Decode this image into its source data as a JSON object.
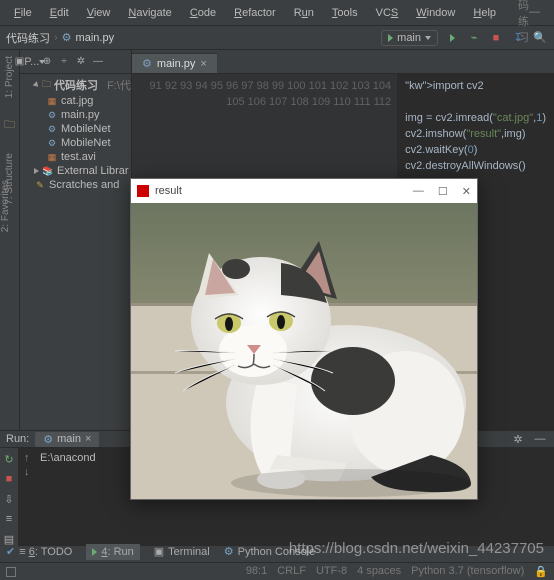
{
  "menu": {
    "file": "File",
    "edit": "Edit",
    "view": "View",
    "navigate": "Navigate",
    "code": "Code",
    "refactor": "Refactor",
    "run": "Run",
    "tools": "Tools",
    "vcs": "VCS",
    "window": "Window",
    "help": "Help"
  },
  "title_hint": "代码练习",
  "breadcrumb": {
    "root": "代码练习",
    "file": "main.py"
  },
  "run_config": "main",
  "sidebar": {
    "header_label": "P...",
    "items": [
      {
        "label": "代码练习",
        "hint": "F:\\代码"
      },
      {
        "label": "cat.jpg"
      },
      {
        "label": "main.py"
      },
      {
        "label": "MobileNet"
      },
      {
        "label": "MobileNet"
      },
      {
        "label": "test.avi"
      },
      {
        "label": "External Librar"
      },
      {
        "label": "Scratches and"
      }
    ]
  },
  "left_tools": {
    "project": "1: Project",
    "structure": "7: Structure",
    "favorites": "2: Favorites"
  },
  "editor": {
    "tab": "main.py",
    "line_start": 91,
    "line_end": 112,
    "code": [
      "import cv2",
      "",
      "img = cv2.imread(\"cat.jpg\",1)",
      "cv2.imshow(\"result\",img)",
      "cv2.waitKey(0)",
      "cv2.destroyAllWindows()",
      ""
    ]
  },
  "run": {
    "title": "Run:",
    "tab": "main",
    "output": "E:\\anacond"
  },
  "bottom": {
    "todo": "6: TODO",
    "run": "4: Run",
    "terminal": "Terminal",
    "python_console": "Python Console"
  },
  "status": {
    "pos": "98:1",
    "line_end": "CRLF",
    "encoding": "UTF-8",
    "indent": "4 spaces",
    "interpreter": "Python 3.7 (tensorflow)"
  },
  "image_window": {
    "title": "result"
  },
  "watermark": "https://blog.csdn.net/weixin_44237705"
}
